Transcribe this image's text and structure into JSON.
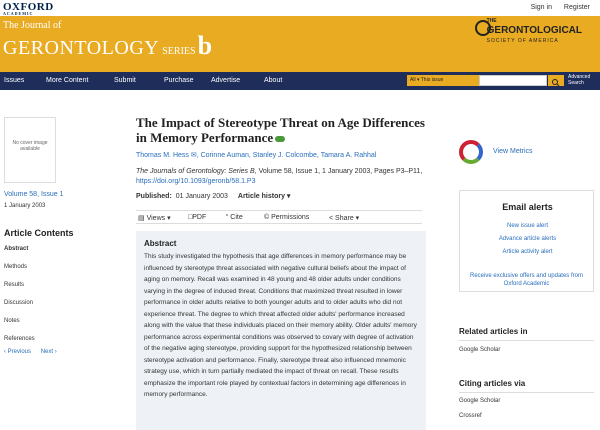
{
  "header": {
    "publisher": "OXFORD",
    "publisher_sub": "ACADEMIC",
    "sign_in": "Sign in",
    "register": "Register"
  },
  "banner": {
    "the": "The Journal of",
    "journal": "GERONTOLOGY",
    "series": "SERIES",
    "letter": "b",
    "society_the": "THE",
    "society_name": "GERONTOLOGICAL",
    "society_sub": "SOCIETY OF AMERICA"
  },
  "nav": {
    "items": [
      "Issues",
      "More Content",
      "Submit",
      "Purchase",
      "Advertise",
      "About"
    ],
    "search_scope": "All ▾  This issue",
    "advanced": "Advanced",
    "search_label": "Search"
  },
  "sidebar": {
    "cover_text": "No cover image available",
    "volume": "Volume 58, Issue 1",
    "date": "1 January 2003",
    "contents_title": "Article Contents",
    "contents": [
      "Abstract",
      "Methods",
      "Results",
      "Discussion",
      "Notes",
      "References"
    ],
    "previous": "‹ Previous",
    "next": "Next ›"
  },
  "article": {
    "title": "The Impact of Stereotype Threat on Age Differences in Memory Performance",
    "authors": "Thomas M. Hess ✉,  Corinne Auman,  Stanley J. Colcombe,  Tamara A. Rahhal",
    "citation_journal": "The Journals of Gerontology: Series B,",
    "citation_rest": " Volume 58, Issue 1, 1 January 2003, Pages P3–P11,",
    "doi": "https://doi.org/10.1093/geronb/58.1.P3",
    "published_label": "Published:",
    "published_date": "01 January 2003",
    "history": "Article history ▾"
  },
  "toolbar": {
    "views": "Views ▾",
    "pdf": "PDF",
    "cite": "Cite",
    "permissions": "Permissions",
    "share": "Share ▾"
  },
  "abstract": {
    "heading": "Abstract",
    "text": "This study investigated the hypothesis that age differences in memory performance may be influenced by stereotype threat associated with negative cultural beliefs about the impact of aging on memory. Recall was examined in 48 young and 48 older adults under conditions varying in the degree of induced threat. Conditions that maximized threat resulted in lower performance in older adults relative to both younger adults and to older adults who did not experience threat. The degree to which threat affected older adults' performance increased along with the value that these individuals placed on their memory ability. Older adults' memory performance across experimental conditions was observed to covary with degree of activation of the negative aging stereotype, providing support for the hypothesized relationship between stereotype activation and performance. Finally, stereotype threat also influenced mnemonic strategy use, which in turn partially mediated the impact of threat on recall. These results emphasize the important role played by contextual factors in determining age differences in memory performance."
  },
  "right": {
    "view_metrics": "View Metrics",
    "alerts_title": "Email alerts",
    "alerts": [
      "New issue alert",
      "Advance article alerts",
      "Article activity alert"
    ],
    "promo": "Receive exclusive offers and updates from Oxford Academic",
    "related_title": "Related articles in",
    "related": [
      "Google Scholar"
    ],
    "citing_title": "Citing articles via",
    "citing": [
      "Google Scholar",
      "Crossref"
    ]
  },
  "colors": {
    "banner": "#e8ab22",
    "nav": "#1e2d5a",
    "link": "#2a6ebb"
  }
}
